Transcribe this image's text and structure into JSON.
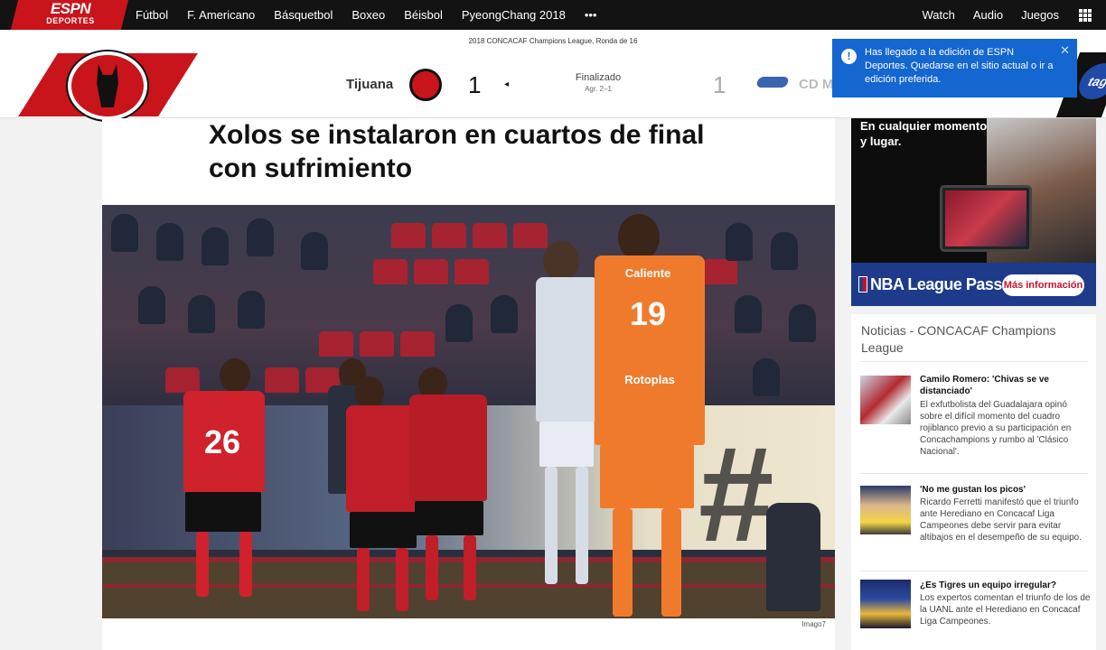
{
  "nav": {
    "logo_line1": "ESPN",
    "logo_line2": "DEPORTES",
    "links": [
      "Fútbol",
      "F. Americano",
      "Básquetbol",
      "Boxeo",
      "Béisbol",
      "PyeongChang 2018"
    ],
    "more": "•••",
    "right_links": [
      "Watch",
      "Audio",
      "Juegos"
    ],
    "grid_icon": "grid-icon"
  },
  "scorebar": {
    "competition": "2018 CONCACAF Champions League, Ronda de 16",
    "home_team": "Tijuana",
    "home_score": "1",
    "arrow": "◂",
    "status": "Finalizado",
    "aggregate": "Agr. 2–1",
    "away_score": "1",
    "away_team": "CD M",
    "away_logo_text": "tag"
  },
  "tooltip": {
    "text": "Has llegado a la edición de ESPN Deportes. Quedarse en el sitio actual o ir a edición preferida.",
    "info_icon": "!",
    "close_icon": "✕"
  },
  "article": {
    "headline": "Xolos se instalaron en cuartos de final con sufrimiento",
    "photo_credit": "Imago7",
    "jersey_numbers": [
      "26",
      "19"
    ],
    "jersey_sponsor_orange": "Caliente",
    "jersey_sponsor_orange2": "Rotoplas"
  },
  "ad": {
    "headline": "En cualquier momento y lugar.",
    "brand": "NBA League Pass",
    "cta": "Más información"
  },
  "news": {
    "title": "Noticias - CONCACAF Champions League",
    "items": [
      {
        "headline": "Camilo Romero: 'Chivas se ve distanciado'",
        "body": "El exfutbolista del Guadalajara opinó sobre el difícil momento del cuadro rojiblanco previo a su participación en Concachampions y rumbo al 'Clásico Nacional'."
      },
      {
        "headline": "'No me gustan los picos'",
        "body": "Ricardo Ferretti manifestó que el triunfo ante Herediano en Concacaf Liga Campeones debe servir para evitar altibajos en el desempeño de su equipo."
      },
      {
        "headline": "¿Es Tigres un equipo irregular?",
        "body": "Los expertos comentan el triunfo de los de la UANL ante el Herediano en Concacaf Liga Campeones."
      }
    ]
  }
}
